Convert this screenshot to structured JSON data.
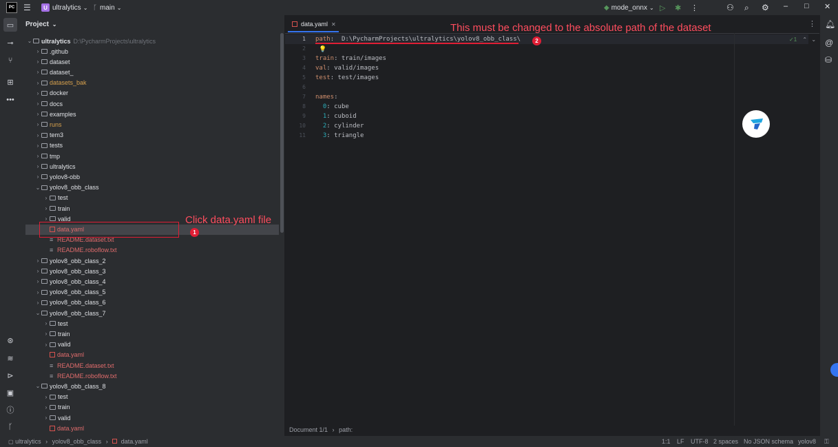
{
  "titlebar": {
    "project_badge": "U",
    "project_name": "ultralytics",
    "branch": "main",
    "run_config": "mode_onnx",
    "logo": "PC"
  },
  "leftbar": {
    "icons": [
      "folder-icon",
      "commit-icon",
      "pull-requests-icon",
      "structure-icon",
      "more-icon",
      "python-packages-icon",
      "layers-icon",
      "services-icon",
      "terminal-icon",
      "problems-icon",
      "git-icon"
    ],
    "more": "•••"
  },
  "project_panel": {
    "header": "Project",
    "root_name": "ultralytics",
    "root_path": "D:\\PycharmProjects\\ultralytics",
    "items": [
      {
        "label": "github",
        "prefix": ".",
        "indent": 1,
        "type": "folder",
        "arrow": "›",
        "color": "#dfe1e5"
      },
      {
        "label": "dataset",
        "prefix": "",
        "indent": 1,
        "type": "folder",
        "arrow": "›",
        "color": "#dfe1e5"
      },
      {
        "label": "dataset_",
        "prefix": "",
        "indent": 1,
        "type": "folder",
        "arrow": "›",
        "color": "#dfe1e5"
      },
      {
        "label": "datasets_bak",
        "prefix": "",
        "indent": 1,
        "type": "folder",
        "arrow": "›",
        "color": "#d6a04d"
      },
      {
        "label": "docker",
        "prefix": "",
        "indent": 1,
        "type": "folder",
        "arrow": "›",
        "color": "#dfe1e5"
      },
      {
        "label": "docs",
        "prefix": "",
        "indent": 1,
        "type": "folder",
        "arrow": "›",
        "color": "#dfe1e5"
      },
      {
        "label": "examples",
        "prefix": "",
        "indent": 1,
        "type": "folder",
        "arrow": "›",
        "color": "#dfe1e5"
      },
      {
        "label": "runs",
        "prefix": "",
        "indent": 1,
        "type": "folder",
        "arrow": "›",
        "color": "#d6a04d"
      },
      {
        "label": "tem3",
        "prefix": "",
        "indent": 1,
        "type": "folder",
        "arrow": "›",
        "color": "#dfe1e5"
      },
      {
        "label": "tests",
        "prefix": "",
        "indent": 1,
        "type": "folder",
        "arrow": "›",
        "color": "#dfe1e5"
      },
      {
        "label": "tmp",
        "prefix": "",
        "indent": 1,
        "type": "folder",
        "arrow": "›",
        "color": "#dfe1e5"
      },
      {
        "label": "ultralytics",
        "prefix": "",
        "indent": 1,
        "type": "folder",
        "arrow": "›",
        "color": "#dfe1e5"
      },
      {
        "label": "yolov8-obb",
        "prefix": "",
        "indent": 1,
        "type": "folder",
        "arrow": "›",
        "color": "#dfe1e5"
      },
      {
        "label": "yolov8_obb_class",
        "prefix": "",
        "indent": 1,
        "type": "folder",
        "arrow": "⌄",
        "color": "#dfe1e5"
      },
      {
        "label": "test",
        "prefix": "",
        "indent": 2,
        "type": "folder",
        "arrow": "›",
        "color": "#dfe1e5"
      },
      {
        "label": "train",
        "prefix": "",
        "indent": 2,
        "type": "folder",
        "arrow": "›",
        "color": "#dfe1e5"
      },
      {
        "label": "valid",
        "prefix": "",
        "indent": 2,
        "type": "folder",
        "arrow": "›",
        "color": "#dfe1e5"
      },
      {
        "label": "data.yaml",
        "prefix": "",
        "indent": 2,
        "type": "yaml",
        "arrow": "",
        "color": "#e06c6c"
      },
      {
        "label": "README.dataset.txt",
        "prefix": "",
        "indent": 2,
        "type": "txt",
        "arrow": "",
        "color": "#e06c6c"
      },
      {
        "label": "README.roboflow.txt",
        "prefix": "",
        "indent": 2,
        "type": "txt",
        "arrow": "",
        "color": "#e06c6c"
      },
      {
        "label": "yolov8_obb_class_2",
        "prefix": "",
        "indent": 1,
        "type": "folder",
        "arrow": "›",
        "color": "#dfe1e5"
      },
      {
        "label": "yolov8_obb_class_3",
        "prefix": "",
        "indent": 1,
        "type": "folder",
        "arrow": "›",
        "color": "#dfe1e5"
      },
      {
        "label": "yolov8_obb_class_4",
        "prefix": "",
        "indent": 1,
        "type": "folder",
        "arrow": "›",
        "color": "#dfe1e5"
      },
      {
        "label": "yolov8_obb_class_5",
        "prefix": "",
        "indent": 1,
        "type": "folder",
        "arrow": "›",
        "color": "#dfe1e5"
      },
      {
        "label": "yolov8_obb_class_6",
        "prefix": "",
        "indent": 1,
        "type": "folder",
        "arrow": "›",
        "color": "#dfe1e5"
      },
      {
        "label": "yolov8_obb_class_7",
        "prefix": "",
        "indent": 1,
        "type": "folder",
        "arrow": "⌄",
        "color": "#dfe1e5"
      },
      {
        "label": "test",
        "prefix": "",
        "indent": 2,
        "type": "folder",
        "arrow": "›",
        "color": "#dfe1e5"
      },
      {
        "label": "train",
        "prefix": "",
        "indent": 2,
        "type": "folder",
        "arrow": "›",
        "color": "#dfe1e5"
      },
      {
        "label": "valid",
        "prefix": "",
        "indent": 2,
        "type": "folder",
        "arrow": "›",
        "color": "#dfe1e5"
      },
      {
        "label": "data.yaml",
        "prefix": "",
        "indent": 2,
        "type": "yaml",
        "arrow": "",
        "color": "#e06c6c"
      },
      {
        "label": "README.dataset.txt",
        "prefix": "",
        "indent": 2,
        "type": "txt",
        "arrow": "",
        "color": "#e06c6c"
      },
      {
        "label": "README.roboflow.txt",
        "prefix": "",
        "indent": 2,
        "type": "txt",
        "arrow": "",
        "color": "#e06c6c"
      },
      {
        "label": "yolov8_obb_class_8",
        "prefix": "",
        "indent": 1,
        "type": "folder",
        "arrow": "⌄",
        "color": "#dfe1e5"
      },
      {
        "label": "test",
        "prefix": "",
        "indent": 2,
        "type": "folder",
        "arrow": "›",
        "color": "#dfe1e5"
      },
      {
        "label": "train",
        "prefix": "",
        "indent": 2,
        "type": "folder",
        "arrow": "›",
        "color": "#dfe1e5"
      },
      {
        "label": "valid",
        "prefix": "",
        "indent": 2,
        "type": "folder",
        "arrow": "›",
        "color": "#dfe1e5"
      },
      {
        "label": "data.yaml",
        "prefix": "",
        "indent": 2,
        "type": "yaml",
        "arrow": "",
        "color": "#e06c6c"
      }
    ]
  },
  "annotations": {
    "callout1_text": "Click data.yaml file",
    "callout1_num": "1",
    "callout2_text": "This must be changed to the absolute path of the dataset",
    "callout2_num": "2"
  },
  "editor": {
    "tab_label": "data.yaml",
    "lines": [
      {
        "n": "1",
        "key": "path",
        "val": "  D:\\PycharmProjects\\ultralytics\\yolov8_obb_class\\"
      },
      {
        "n": "2",
        "key": "",
        "val": ""
      },
      {
        "n": "3",
        "key": "train",
        "val": " train/images"
      },
      {
        "n": "4",
        "key": "val",
        "val": " valid/images"
      },
      {
        "n": "5",
        "key": "test",
        "val": " test/images"
      },
      {
        "n": "6",
        "key": "",
        "val": ""
      },
      {
        "n": "7",
        "key": "names",
        "val": ""
      },
      {
        "n": "8",
        "key": "  0",
        "val": " cube"
      },
      {
        "n": "9",
        "key": "  1",
        "val": " cuboid"
      },
      {
        "n": "10",
        "key": "  2",
        "val": " cylinder"
      },
      {
        "n": "11",
        "key": "  3",
        "val": " triangle"
      }
    ],
    "inspection": "✓1",
    "breadcrumb_doc": "Document 1/1",
    "breadcrumb_key": "path:"
  },
  "statusbar": {
    "crumb_root": "ultralytics",
    "crumb_folder": "yolov8_obb_class",
    "crumb_file": "data.yaml",
    "position": "1:1",
    "line_ending": "LF",
    "encoding": "UTF-8",
    "indent": "2 spaces",
    "schema": "No JSON schema",
    "interpreter": "yolov8"
  }
}
